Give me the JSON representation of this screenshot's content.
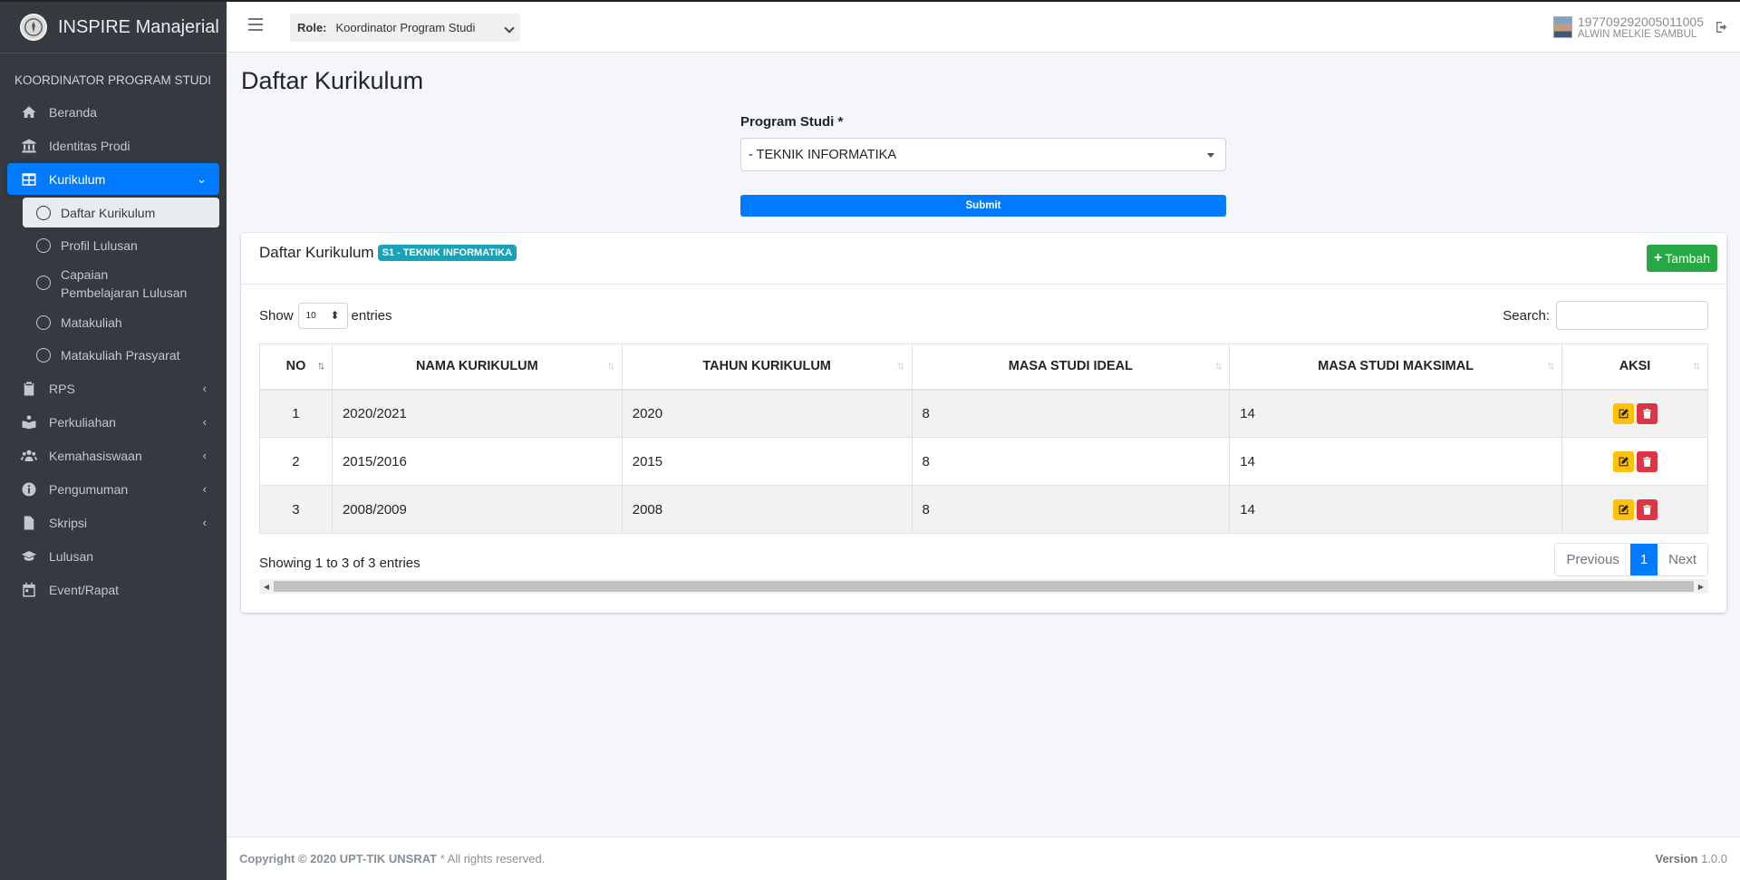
{
  "brand": {
    "name": "INSPIRE Manajerial"
  },
  "sidebar": {
    "header": "KOORDINATOR PROGRAM STUDI",
    "items": [
      {
        "label": "Beranda",
        "icon": "home-icon"
      },
      {
        "label": "Identitas Prodi",
        "icon": "bank-icon"
      },
      {
        "label": "Kurikulum",
        "icon": "table-icon"
      },
      {
        "label": "RPS",
        "icon": "clipboard-icon"
      },
      {
        "label": "Perkuliahan",
        "icon": "reader-icon"
      },
      {
        "label": "Kemahasiswaan",
        "icon": "users-icon"
      },
      {
        "label": "Pengumuman",
        "icon": "info-icon"
      },
      {
        "label": "Skripsi",
        "icon": "file-icon"
      },
      {
        "label": "Lulusan",
        "icon": "graduation-cap-icon"
      },
      {
        "label": "Event/Rapat",
        "icon": "calendar-icon"
      }
    ],
    "sub_items": [
      {
        "label": "Daftar Kurikulum"
      },
      {
        "label": "Profil Lulusan"
      },
      {
        "label_line1": "Capaian",
        "label_line2": "Pembelajaran Lulusan"
      },
      {
        "label": "Matakuliah"
      },
      {
        "label": "Matakuliah Prasyarat"
      }
    ]
  },
  "topbar": {
    "role_label": "Role:",
    "role_value": "Koordinator Program Studi",
    "user_id": "197709292005011005",
    "user_name": "ALWIN MELKIE SAMBUL"
  },
  "page": {
    "title": "Daftar Kurikulum",
    "program_label": "Program Studi *",
    "program_value": "- TEKNIK INFORMATIKA",
    "submit_label": "Submit"
  },
  "card": {
    "title": "Daftar Kurikulum",
    "badge": "S1 - TEKNIK INFORMATIKA",
    "tambah_label": "Tambah",
    "show_label": "Show",
    "entries_value": "10",
    "entries_label": "entries",
    "search_label": "Search:",
    "columns": [
      "NO",
      "NAMA KURIKULUM",
      "TAHUN KURIKULUM",
      "MASA STUDI IDEAL",
      "MASA STUDI MAKSIMAL",
      "AKSI"
    ],
    "rows": [
      {
        "no": "1",
        "nama": "2020/2021",
        "tahun": "2020",
        "ideal": "8",
        "maksimal": "14"
      },
      {
        "no": "2",
        "nama": "2015/2016",
        "tahun": "2015",
        "ideal": "8",
        "maksimal": "14"
      },
      {
        "no": "3",
        "nama": "2008/2009",
        "tahun": "2008",
        "ideal": "8",
        "maksimal": "14"
      }
    ],
    "info": "Showing 1 to 3 of 3 entries",
    "pagination": {
      "previous": "Previous",
      "current": "1",
      "next": "Next"
    }
  },
  "footer": {
    "copyright": "Copyright © 2020 UPT-TIK UNSRAT",
    "rights": " * All rights reserved.",
    "version_label": "Version",
    "version_value": " 1.0.0"
  },
  "colors": {
    "primary": "#007bff",
    "sidebar": "#343a40",
    "success": "#28a745",
    "info": "#17a2b8",
    "warning": "#ffc107",
    "danger": "#dc3545"
  }
}
